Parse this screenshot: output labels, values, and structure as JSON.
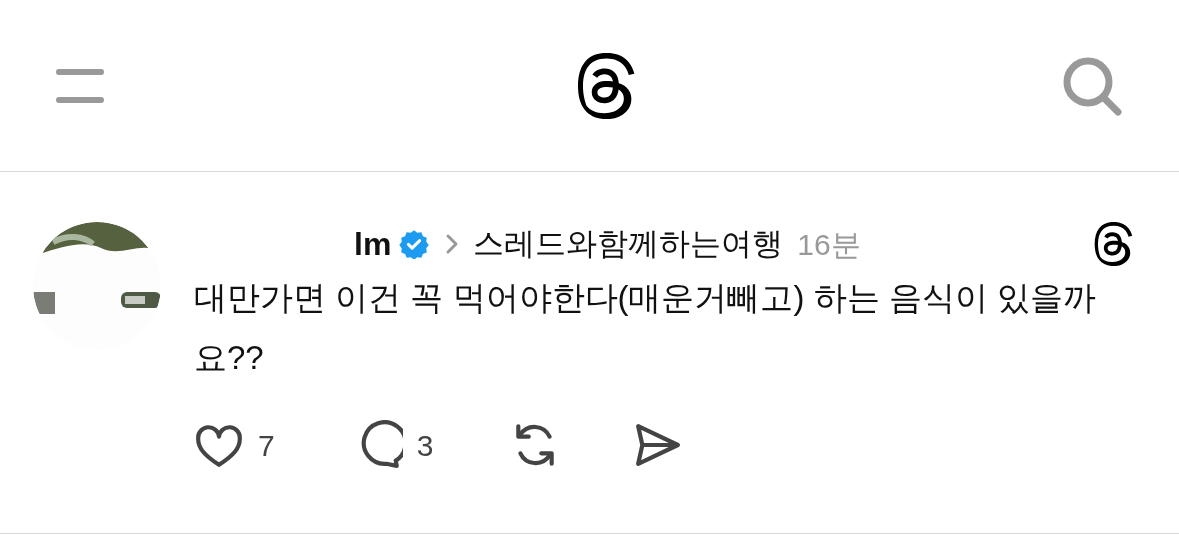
{
  "post": {
    "author": "lm",
    "verified": true,
    "topic": "스레드와함께하는여행",
    "time": "16분",
    "text": "대만가면 이건 꼭 먹어야한다(매운거빼고) 하는 음식이 있을까요??",
    "likes": "7",
    "replies": "3"
  }
}
